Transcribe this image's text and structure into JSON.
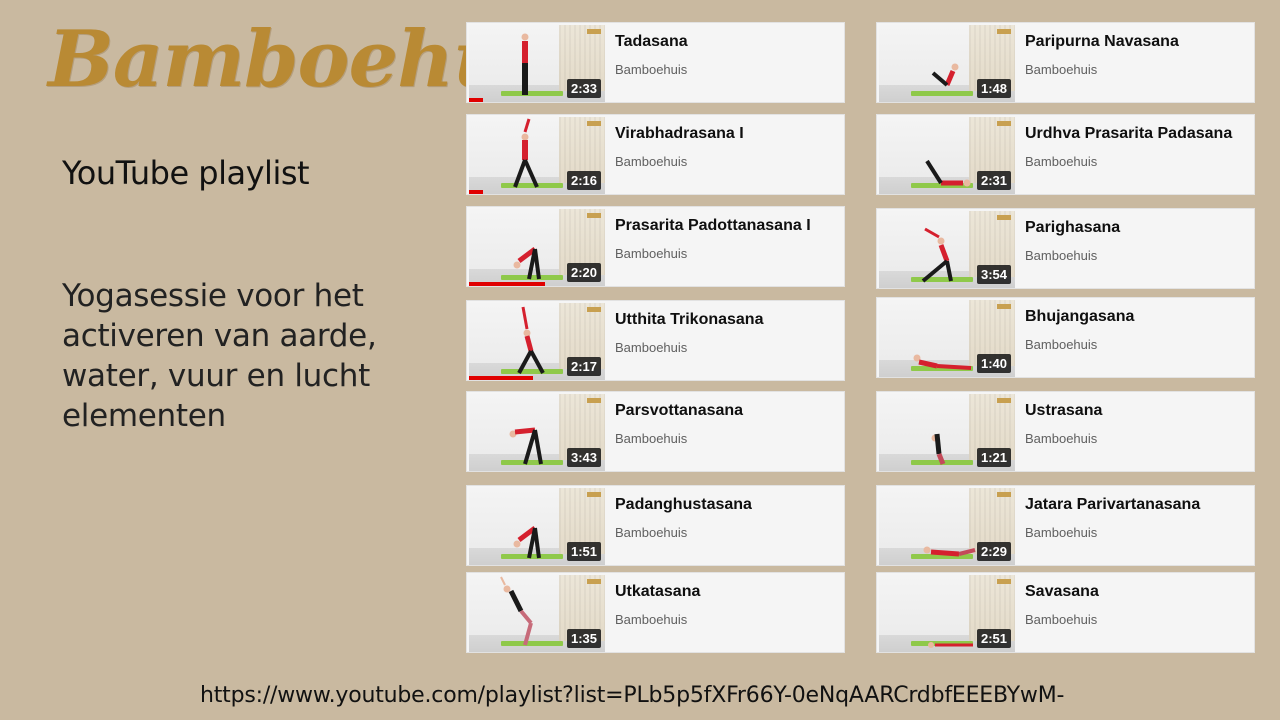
{
  "logo": "Bamboehuis",
  "subtitle": "YouTube playlist",
  "description": "Yogasessie  voor het activeren van aarde, water, vuur en lucht elementen",
  "url": "https://www.youtube.com/playlist?list=PLb5p5fXFr66Y-0eNqAARCrdbfEEEBYwM-",
  "colors": {
    "background": "#c9b9a0",
    "logo": "#b98a34",
    "progress": "#e00000",
    "mat": "#8fc94a"
  },
  "left_videos": [
    {
      "title": "Tadasana",
      "channel": "Bamboehuis",
      "duration": "2:33",
      "progress": 0.1,
      "pose": "standing"
    },
    {
      "title": "Virabhadrasana I",
      "channel": "Bamboehuis",
      "duration": "2:16",
      "progress": 0.1,
      "pose": "warrior"
    },
    {
      "title": "Prasarita Padottanasana I",
      "channel": "Bamboehuis",
      "duration": "2:20",
      "progress": 0.56,
      "pose": "forward-fold"
    },
    {
      "title": "Utthita Trikonasana",
      "channel": "Bamboehuis",
      "duration": "2:17",
      "progress": 0.47,
      "pose": "triangle"
    },
    {
      "title": "Parsvottanasana",
      "channel": "Bamboehuis",
      "duration": "3:43",
      "progress": 0,
      "pose": "pyramid"
    },
    {
      "title": "Padanghustasana",
      "channel": "Bamboehuis",
      "duration": "1:51",
      "progress": 0,
      "pose": "forward-fold"
    },
    {
      "title": "Utkatasana",
      "channel": "Bamboehuis",
      "duration": "1:35",
      "progress": 0,
      "pose": "chair"
    }
  ],
  "right_videos": [
    {
      "title": "Paripurna Navasana",
      "channel": "Bamboehuis",
      "duration": "1:48",
      "progress": 0,
      "pose": "boat"
    },
    {
      "title": "Urdhva Prasarita Padasana",
      "channel": "Bamboehuis",
      "duration": "2:31",
      "progress": 0,
      "pose": "leg-raise"
    },
    {
      "title": "Parighasana",
      "channel": "Bamboehuis",
      "duration": "3:54",
      "progress": 0,
      "pose": "gate"
    },
    {
      "title": "Bhujangasana",
      "channel": "Bamboehuis",
      "duration": "1:40",
      "progress": 0,
      "pose": "cobra"
    },
    {
      "title": "Ustrasana",
      "channel": "Bamboehuis",
      "duration": "1:21",
      "progress": 0,
      "pose": "camel"
    },
    {
      "title": "Jatara Parivartanasana",
      "channel": "Bamboehuis",
      "duration": "2:29",
      "progress": 0,
      "pose": "twist"
    },
    {
      "title": "Savasana",
      "channel": "Bamboehuis",
      "duration": "2:51",
      "progress": 0,
      "pose": "lying"
    }
  ]
}
